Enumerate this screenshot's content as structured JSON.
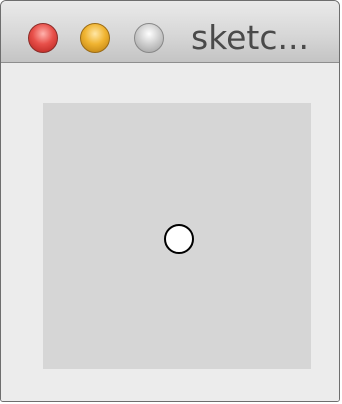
{
  "window": {
    "title": "sketc..."
  },
  "titlebar_buttons": [
    {
      "name": "close",
      "color": "#e8504a"
    },
    {
      "name": "minimize",
      "color": "#f0b431"
    },
    {
      "name": "zoom",
      "color": "#c8c8c8"
    }
  ],
  "sketch": {
    "background_color": "#d6d6d6",
    "dot_fill": "#ffffff",
    "dot_stroke": "#000000"
  }
}
